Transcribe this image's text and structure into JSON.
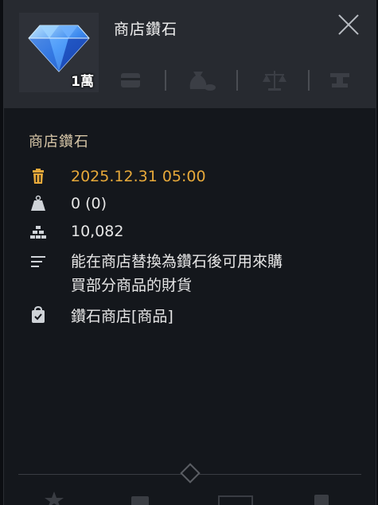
{
  "item": {
    "name": "商店鑽石",
    "quantity": "1萬"
  },
  "section": {
    "title": "商店鑽石"
  },
  "details": {
    "expiry": "2025.12.31 05:00",
    "weight": "0 (0)",
    "stack": "10,082",
    "description_line1": "能在商店替換為鑽石後可用來購",
    "description_line2": "買部分商品的財貨",
    "source": "鑽石商店[商品]"
  },
  "colors": {
    "expiry": "#e7a93a",
    "header_bg": "#272a30",
    "panel_bg": "#14171c",
    "section_title": "#d8c7a8"
  },
  "icons": {
    "header": [
      "chest-icon",
      "bag-coin-icon",
      "scale-icon",
      "anvil-icon"
    ],
    "details": [
      "trash-icon",
      "weight-icon",
      "stack-icon",
      "description-icon",
      "source-icon"
    ]
  }
}
